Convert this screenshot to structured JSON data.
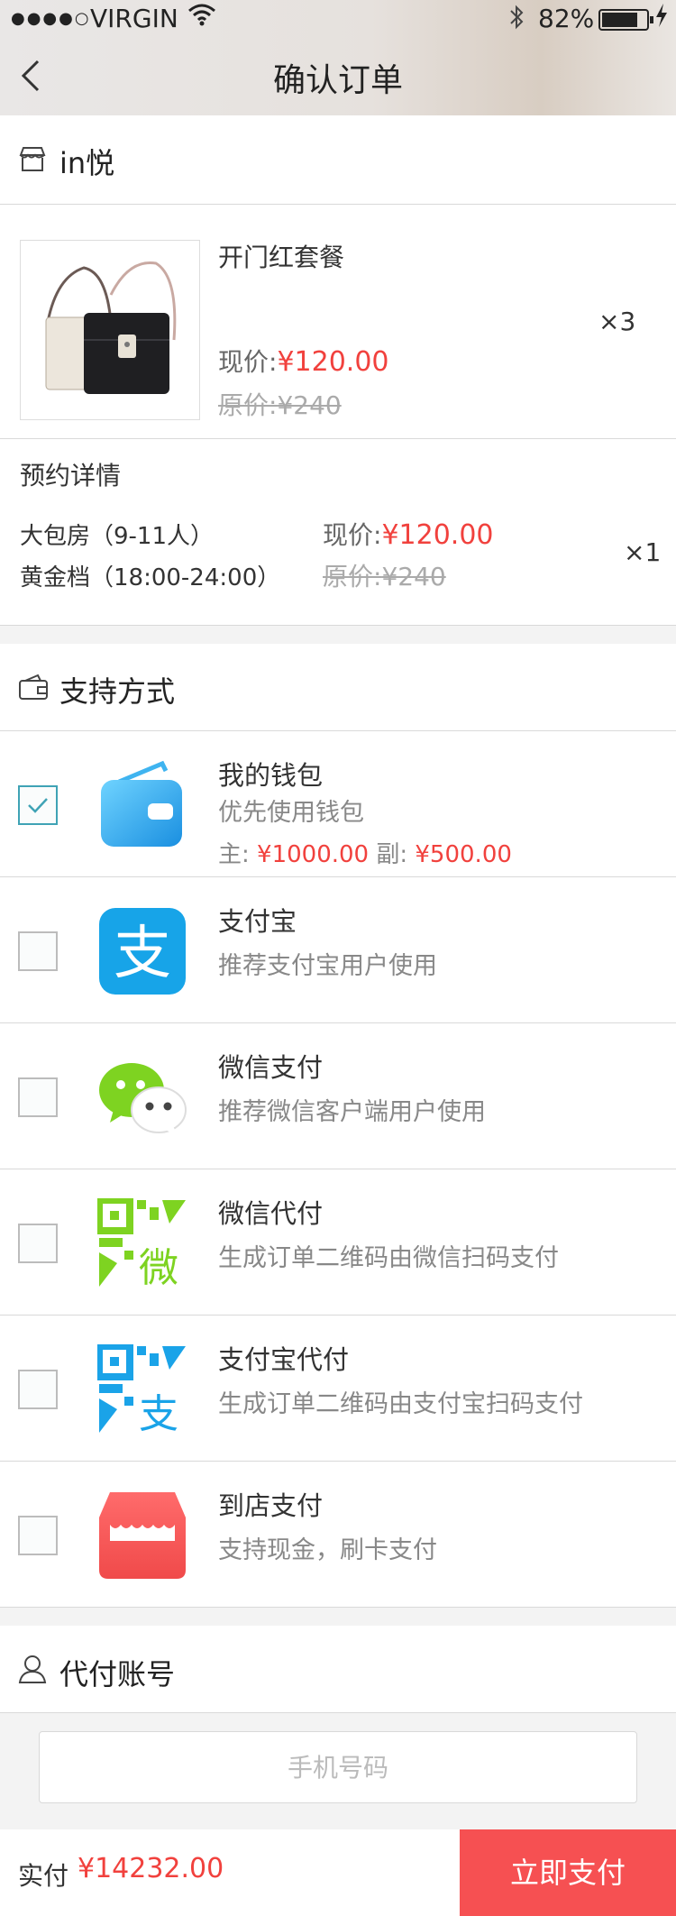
{
  "status_bar": {
    "signal_dots": "●●●●○",
    "carrier": "VIRGIN",
    "battery_pct": "82%",
    "battery_level": 0.82
  },
  "nav": {
    "title": "确认订单",
    "back_icon": "chevron-left-icon"
  },
  "shop": {
    "icon": "store-icon",
    "name": "in悦"
  },
  "product": {
    "image_icon": "handbag-product-image",
    "name": "开门红套餐",
    "now_label": "现价:",
    "now_price": "¥120.00",
    "orig_label": "原价:",
    "orig_price": "¥240",
    "qty": "×3"
  },
  "reservation": {
    "heading": "预约详情",
    "room": "大包房（9-11人）",
    "slot": "黄金档（18:00-24:00）",
    "now_label": "现价:",
    "now_price": "¥120.00",
    "orig_label": "原价:",
    "orig_price": "¥240",
    "qty": "×1"
  },
  "payment": {
    "heading": "支持方式",
    "heading_icon": "wallet-outline-icon",
    "methods": [
      {
        "name": "我的钱包",
        "desc": "优先使用钱包",
        "icon": "wallet-icon",
        "checked": true,
        "main_label": "主:",
        "main_amount": "¥1000.00",
        "sub_label": "副:",
        "sub_amount": "¥500.00"
      },
      {
        "name": "支付宝",
        "desc": "推荐支付宝用户使用",
        "icon": "alipay-icon",
        "checked": false
      },
      {
        "name": "微信支付",
        "desc": "推荐微信客户端用户使用",
        "icon": "wechat-icon",
        "checked": false
      },
      {
        "name": "微信代付",
        "desc": "生成订单二维码由微信扫码支付",
        "icon": "wechat-qr-icon",
        "checked": false,
        "glyph": "微"
      },
      {
        "name": "支付宝代付",
        "desc": "生成订单二维码由支付宝扫码支付",
        "icon": "alipay-qr-icon",
        "checked": false,
        "glyph": "支"
      },
      {
        "name": "到店支付",
        "desc": "支持现金，刷卡支付",
        "icon": "store-pay-icon",
        "checked": false
      }
    ],
    "alipay_glyph": "支"
  },
  "proxy": {
    "heading": "代付账号",
    "heading_icon": "user-icon",
    "phone_placeholder": "手机号码",
    "phone_value": ""
  },
  "footer": {
    "total_label": "实付",
    "total_amount": "¥14232.00",
    "pay_button": "立即支付"
  },
  "colors": {
    "accent_red": "#f1413d",
    "pay_button": "#f65052",
    "check_teal": "#3fa3b5",
    "wechat_green": "#7ed321",
    "alipay_blue": "#1aa3e8"
  }
}
